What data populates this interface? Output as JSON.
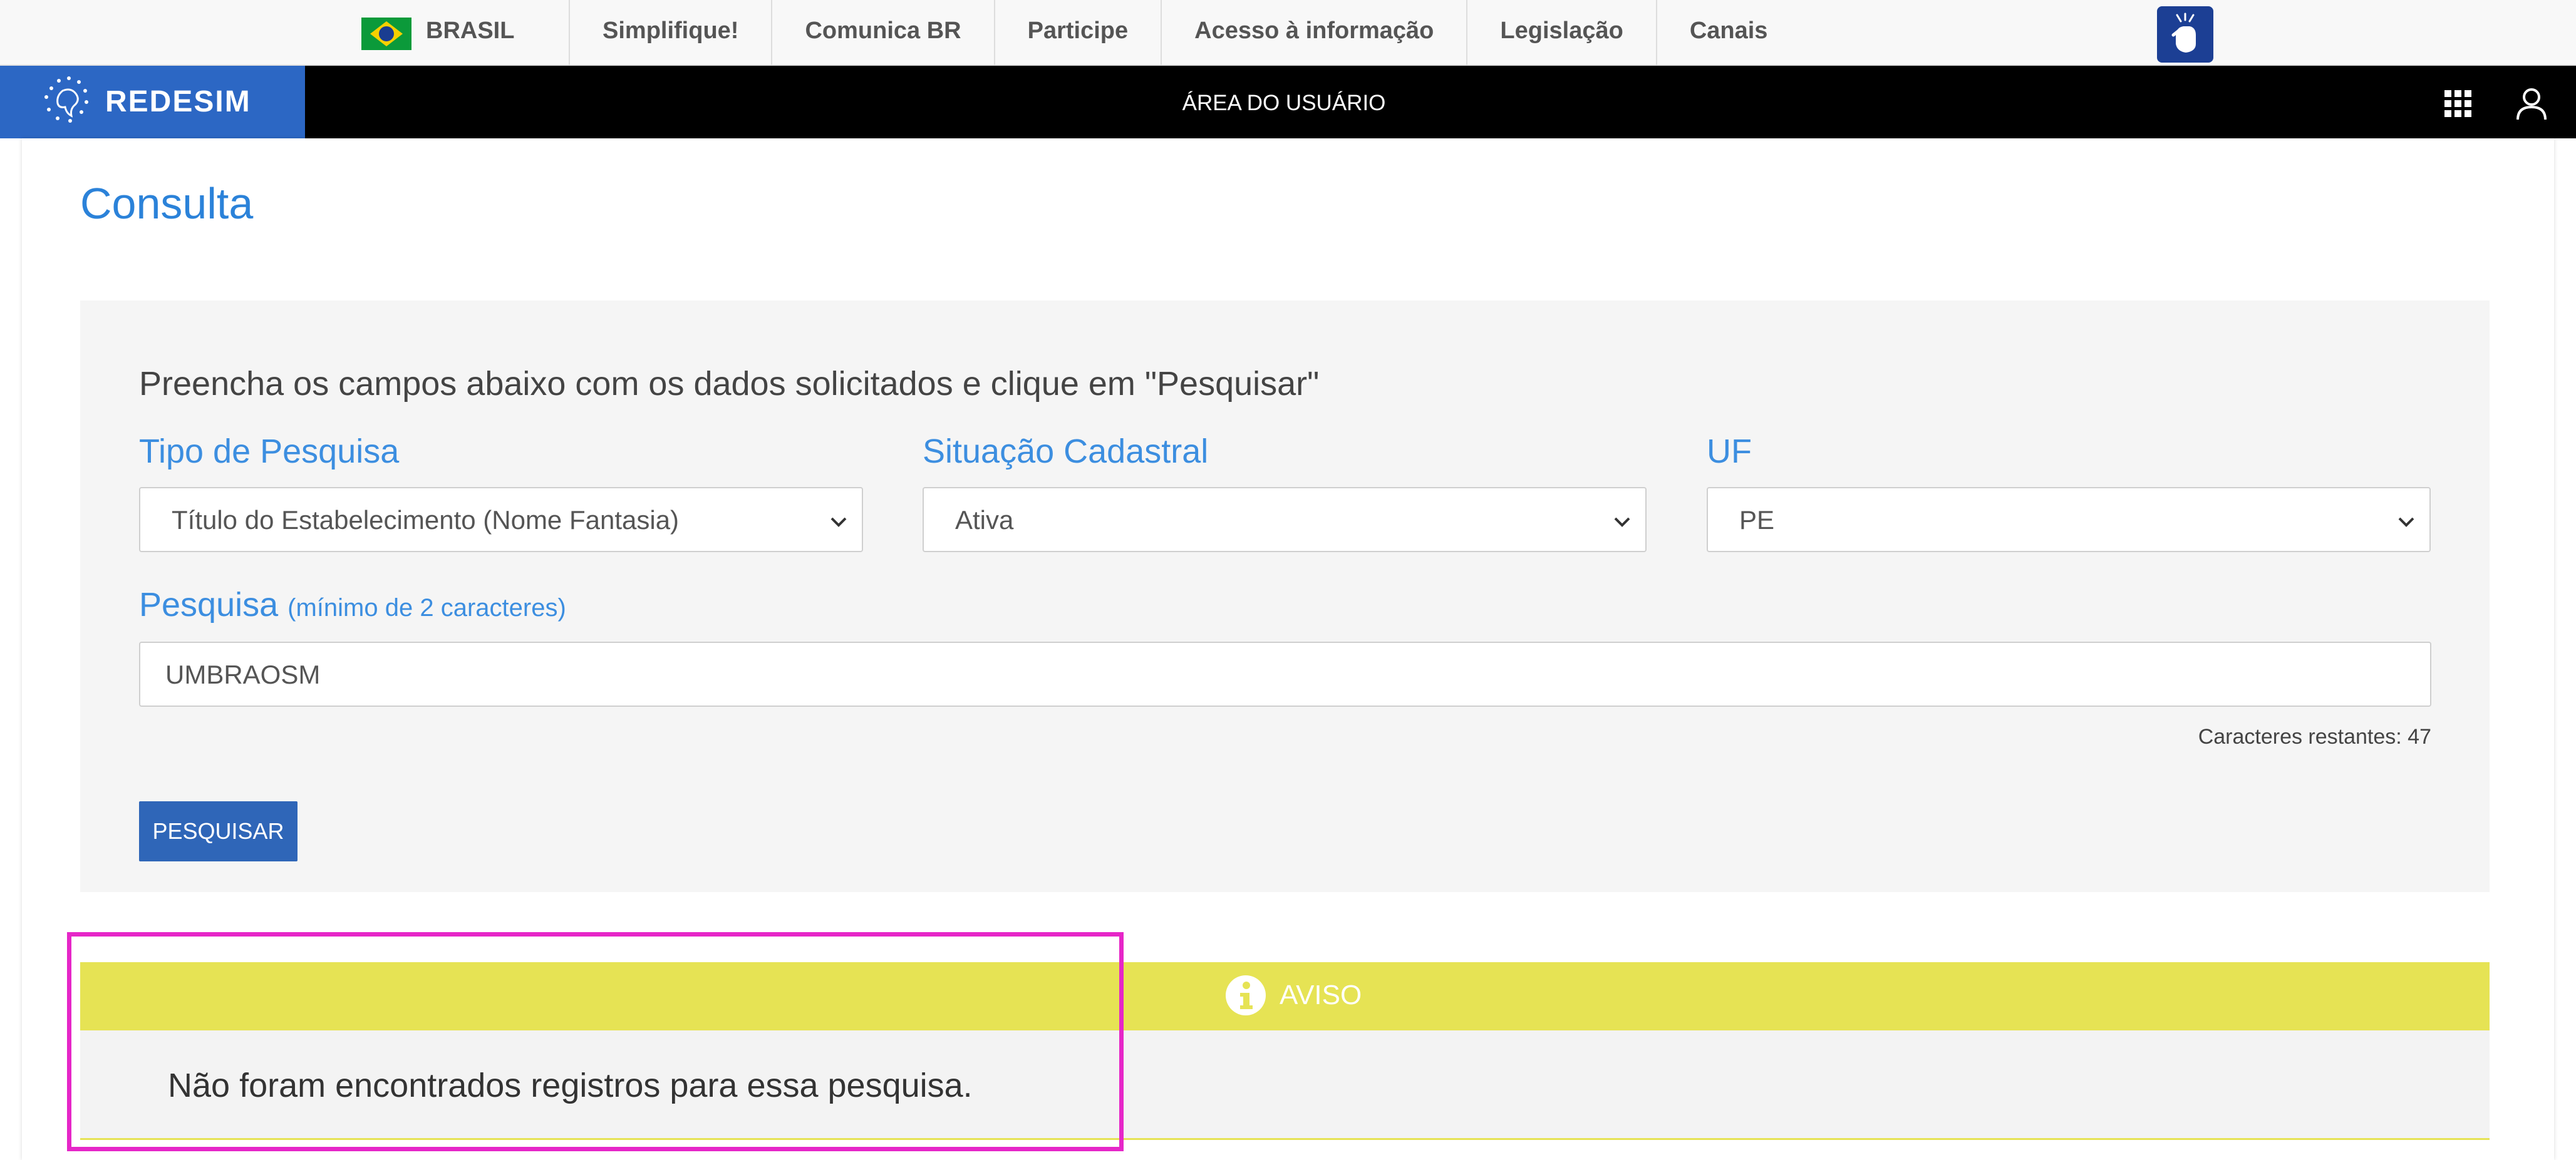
{
  "gov_bar": {
    "brand_label": "BRASIL",
    "links": [
      "Simplifique!",
      "Comunica BR",
      "Participe",
      "Acesso à informação",
      "Legislação",
      "Canais"
    ],
    "accessibility_icon": "vlibras-hand-icon"
  },
  "app_bar": {
    "logo_text": "REDESIM",
    "title": "ÁREA DO USUÁRIO",
    "icons": [
      "apps-grid-icon",
      "user-icon"
    ]
  },
  "page": {
    "title": "Consulta",
    "instructions": "Preencha os campos abaixo com os dados solicitados e clique em \"Pesquisar\""
  },
  "form": {
    "tipo": {
      "label": "Tipo de Pesquisa",
      "value": "Título do Estabelecimento (Nome Fantasia)"
    },
    "situacao": {
      "label": "Situação Cadastral",
      "value": "Ativa"
    },
    "uf": {
      "label": "UF",
      "value": "PE"
    },
    "pesquisa": {
      "label": "Pesquisa",
      "hint": "(mínimo de 2 caracteres)",
      "value": "UMBRAOSM"
    },
    "counter": "Caracteres restantes: 47",
    "button": "PESQUISAR"
  },
  "notice": {
    "title": "AVISO",
    "message": "Não foram encontrados registros para essa pesquisa."
  },
  "colors": {
    "brand_blue": "#2c67c4",
    "label_blue": "#3c8ee0",
    "notice_yellow": "#e6e354",
    "highlight_magenta": "#e626c8"
  }
}
